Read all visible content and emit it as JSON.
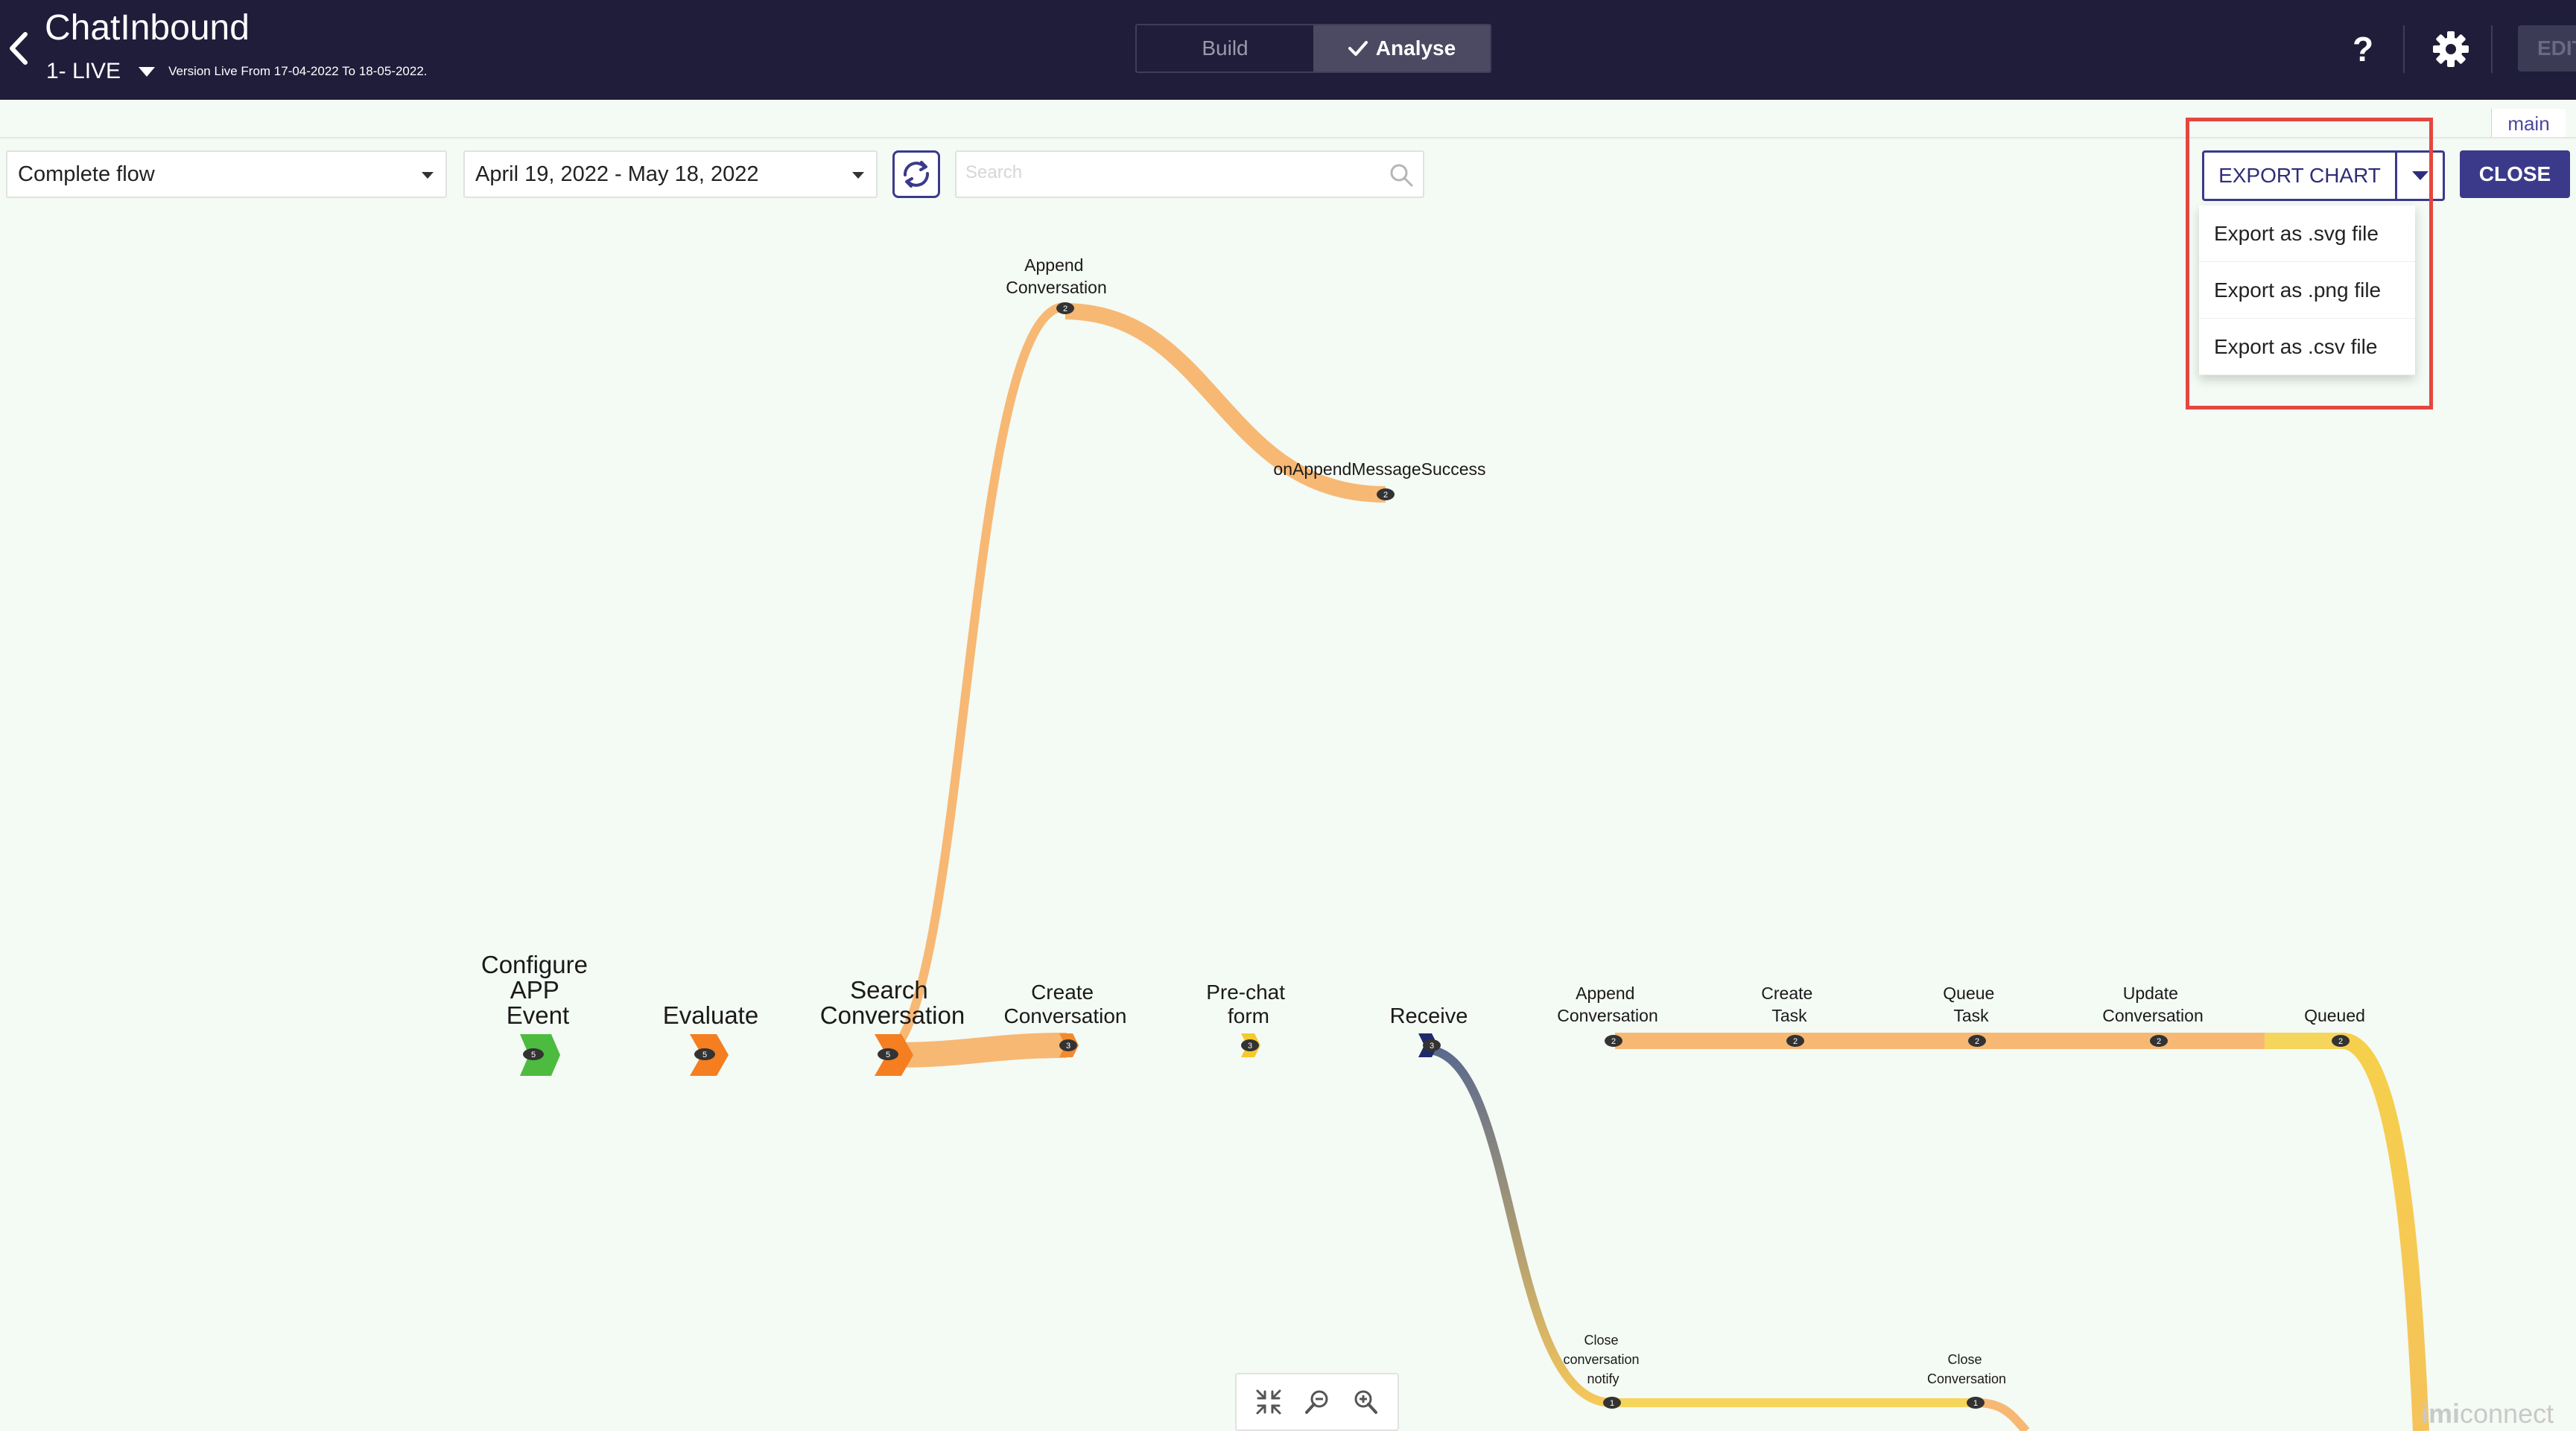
{
  "header": {
    "back_icon": "chevron-left-icon",
    "title": "ChatInbound",
    "version": "1- LIVE",
    "version_range": "Version Live From 17-04-2022 To 18-05-2022.",
    "mode_tabs": [
      {
        "label": "Build",
        "active": false
      },
      {
        "label": "Analyse",
        "active": true
      }
    ],
    "help_label": "?",
    "settings_icon": "gear-icon",
    "edit_label": "EDIT"
  },
  "main_tab_label": "main",
  "toolbar": {
    "flow_select": "Complete flow",
    "date_range": "April 19, 2022 - May 18, 2022",
    "refresh_icon": "refresh-icon",
    "search_placeholder": "Search"
  },
  "export": {
    "button_label": "EXPORT CHART",
    "close_label": "CLOSE",
    "menu": [
      "Export as .svg file",
      "Export as .png file",
      "Export as .csv file"
    ]
  },
  "colors": {
    "header_bg": "#1f1d3a",
    "accent": "#3b3a8a",
    "highlight": "#e4473f",
    "flow_orange": "#f7b874",
    "flow_yellow": "#f6d55c",
    "flow_green": "#4dbb40",
    "flow_navy": "#1f2a6a"
  },
  "flow": {
    "nodes": [
      {
        "id": "configure",
        "lines": [
          "Configure",
          "APP",
          "Event"
        ],
        "count": "5"
      },
      {
        "id": "evaluate",
        "lines": [
          "Evaluate"
        ],
        "count": "5"
      },
      {
        "id": "search",
        "lines": [
          "Search",
          "Conversation"
        ],
        "count": "5"
      },
      {
        "id": "create-conv",
        "lines": [
          "Create",
          "Conversation"
        ],
        "count": "3"
      },
      {
        "id": "prechat",
        "lines": [
          "Pre-chat",
          "form"
        ],
        "count": "3"
      },
      {
        "id": "receive",
        "lines": [
          "Receive"
        ],
        "count": "3"
      },
      {
        "id": "append-conv-main",
        "lines": [
          "Append",
          "Conversation"
        ],
        "count": "2"
      },
      {
        "id": "create-task",
        "lines": [
          "Create",
          "Task"
        ],
        "count": "2"
      },
      {
        "id": "queue-task",
        "lines": [
          "Queue",
          "Task"
        ],
        "count": "2"
      },
      {
        "id": "update-conv",
        "lines": [
          "Update",
          "Conversation"
        ],
        "count": "2"
      },
      {
        "id": "queued",
        "lines": [
          "Queued"
        ],
        "count": "2"
      },
      {
        "id": "append-conv-top",
        "lines": [
          "Append",
          "Conversation"
        ],
        "count": "2"
      },
      {
        "id": "on-append",
        "lines": [
          "onAppendMessageSuccess"
        ],
        "count": "2"
      },
      {
        "id": "close-notify",
        "lines": [
          "Close",
          "conversation",
          "notify"
        ],
        "count": "1"
      },
      {
        "id": "close-conv",
        "lines": [
          "Close",
          "Conversation"
        ],
        "count": "1"
      }
    ]
  },
  "zoom_controls": [
    "collapse-icon",
    "zoom-out-icon",
    "zoom-in-icon"
  ],
  "brand": {
    "part1": "imi",
    "part2": "connect"
  }
}
